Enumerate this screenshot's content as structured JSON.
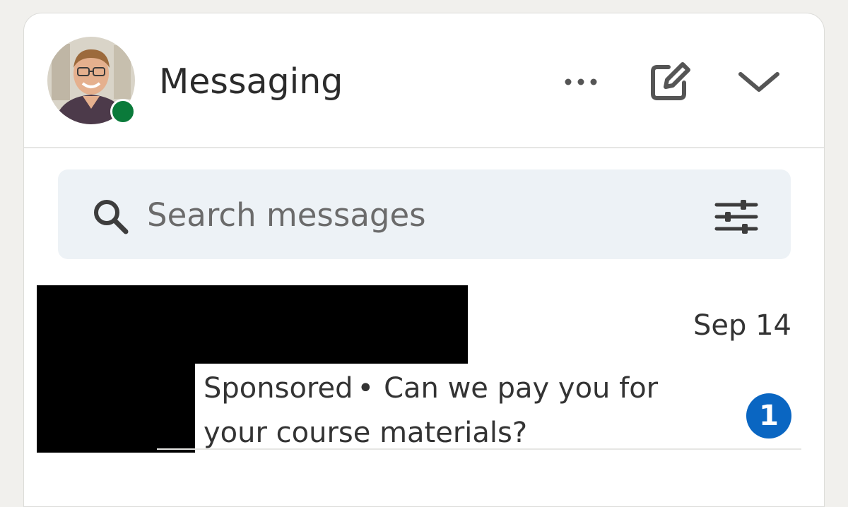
{
  "header": {
    "title": "Messaging",
    "presence_status_color": "#0a7a3a",
    "icons": {
      "more": "ellipsis-icon",
      "compose": "compose-icon",
      "collapse": "chevron-down-icon"
    }
  },
  "search": {
    "placeholder": "Search messages",
    "value": "",
    "icons": {
      "search": "search-icon",
      "filter": "filter-sliders-icon"
    }
  },
  "conversations": [
    {
      "sender": "[redacted]",
      "date": "Sep 14",
      "label": "Sponsored",
      "separator": "•",
      "preview": "Can we pay you for your course materials?",
      "unread_count": "1"
    }
  ],
  "colors": {
    "accent": "#0a66c2",
    "search_bg": "#edf2f6",
    "page_bg": "#f1f0ed"
  }
}
